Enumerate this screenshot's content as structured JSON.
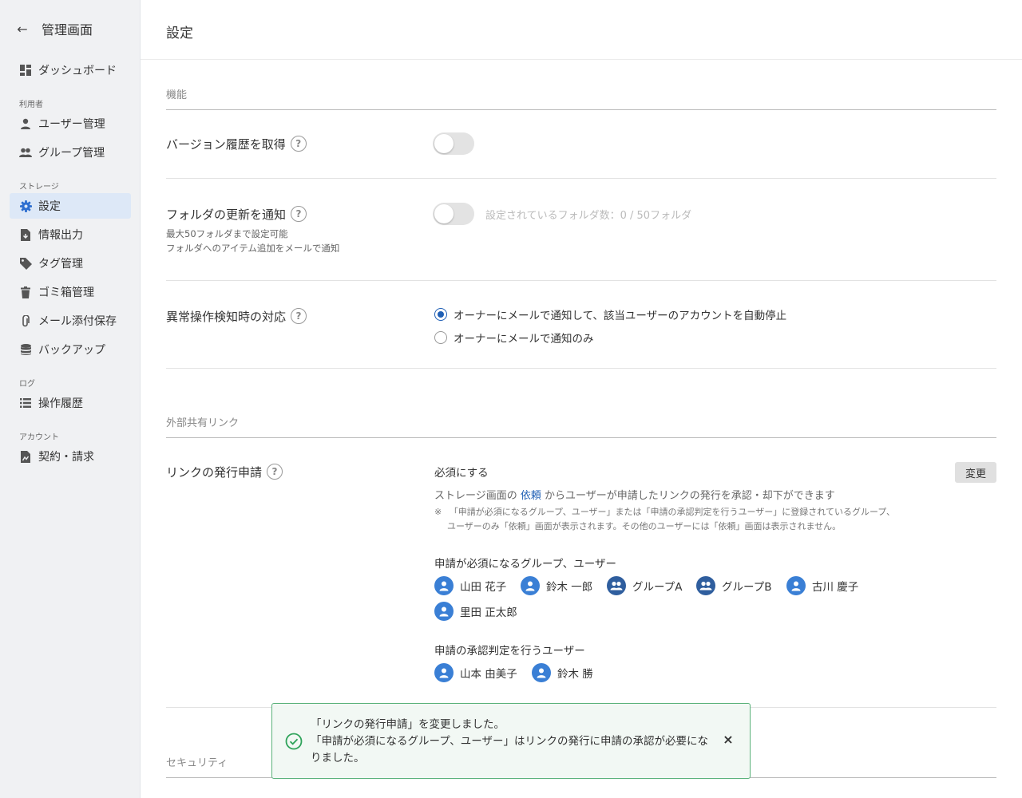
{
  "sidebar": {
    "back_label": "←",
    "title": "管理画面",
    "items": [
      {
        "label": "ダッシュボード"
      },
      {
        "label": "ユーザー管理"
      },
      {
        "label": "グループ管理"
      },
      {
        "label": "設定"
      },
      {
        "label": "情報出力"
      },
      {
        "label": "タグ管理"
      },
      {
        "label": "ゴミ箱管理"
      },
      {
        "label": "メール添付保存"
      },
      {
        "label": "バックアップ"
      },
      {
        "label": "操作履歴"
      },
      {
        "label": "契約・請求"
      }
    ],
    "categories": {
      "users": "利用者",
      "storage": "ストレージ",
      "log": "ログ",
      "account": "アカウント"
    },
    "active_item": "設定"
  },
  "header": {
    "title": "設定"
  },
  "sections": {
    "features": {
      "title": "機能",
      "version_history": {
        "label": "バージョン履歴を取得",
        "help": "?",
        "enabled": false
      },
      "folder_notify": {
        "label": "フォルダの更新を通知",
        "help": "?",
        "enabled": false,
        "sub1": "最大50フォルダまで設定可能",
        "sub2": "フォルダへのアイテム追加をメールで通知",
        "count_text": "設定されているフォルダ数：0 / 50フォルダ"
      },
      "anomaly": {
        "label": "異常操作検知時の対応",
        "help": "?",
        "options": [
          {
            "label": "オーナーにメールで通知して、該当ユーザーのアカウントを自動停止",
            "checked": true
          },
          {
            "label": "オーナーにメールで通知のみ",
            "checked": false
          }
        ]
      }
    },
    "external_links": {
      "title": "外部共有リンク",
      "link_request": {
        "label": "リンクの発行申請",
        "help": "?",
        "status": "必須にする",
        "change_button": "変更",
        "desc_before": "ストレージ画面の",
        "desc_link": "依頼",
        "desc_after": "からユーザーが申請したリンクの発行を承認・却下ができます",
        "note_mark": "※",
        "note_line1": "「申請が必須になるグループ、ユーザー」または「申請の承認判定を行うユーザー」に登録されているグループ、",
        "note_line2": "ユーザーのみ「依頼」画面が表示されます。その他のユーザーには「依頼」画面は表示されません。",
        "required_heading": "申請が必須になるグループ、ユーザー",
        "required_members": [
          {
            "name": "山田 花子",
            "type": "user"
          },
          {
            "name": "鈴木 一郎",
            "type": "user"
          },
          {
            "name": "グループA",
            "type": "group"
          },
          {
            "name": "グループB",
            "type": "group"
          },
          {
            "name": "古川 慶子",
            "type": "user"
          },
          {
            "name": "里田 正太郎",
            "type": "user"
          }
        ],
        "approver_heading": "申請の承認判定を行うユーザー",
        "approvers": [
          {
            "name": "山本 由美子",
            "type": "user"
          },
          {
            "name": "鈴木 勝",
            "type": "user"
          }
        ]
      }
    },
    "security": {
      "title": "セキュリティ"
    }
  },
  "toast": {
    "line1": "「リンクの発行申請」を変更しました。",
    "line2": "「申請が必須になるグループ、ユーザー」はリンクの発行に申請の承認が必要になりました。",
    "close": "×"
  },
  "colors": {
    "accent": "#2e6fd0",
    "avatar_user": "#3a7fd5",
    "avatar_group": "#2f5e9e",
    "success": "#5bb27b"
  }
}
